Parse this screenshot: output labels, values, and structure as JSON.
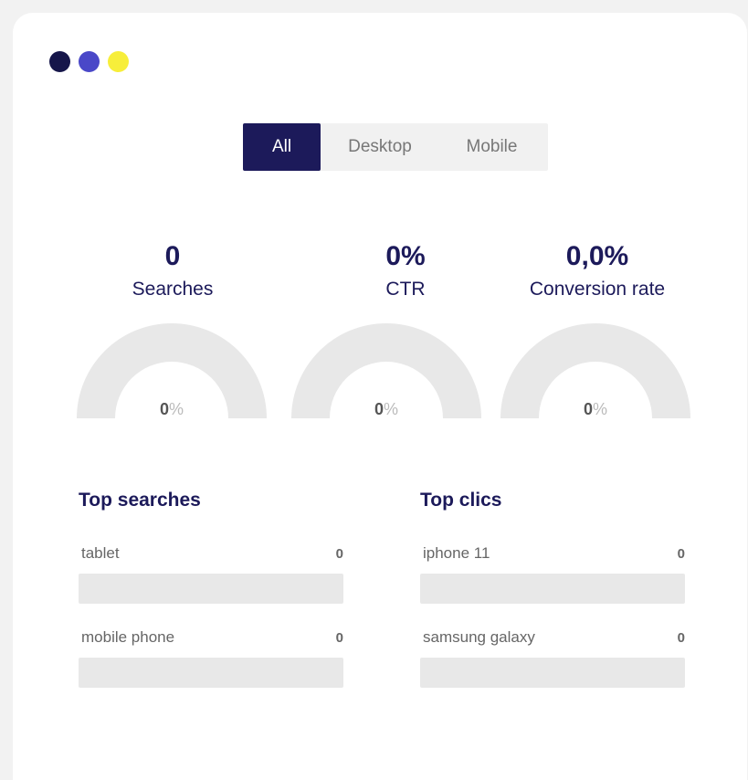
{
  "window_dots": [
    {
      "name": "dot-navy",
      "color": "#16164a"
    },
    {
      "name": "dot-indigo",
      "color": "#4a48c8"
    },
    {
      "name": "dot-yellow",
      "color": "#f7ee3a"
    }
  ],
  "tabs": [
    {
      "label": "All",
      "selected": true
    },
    {
      "label": "Desktop",
      "selected": false
    },
    {
      "label": "Mobile",
      "selected": false
    }
  ],
  "metrics": [
    {
      "value": "0",
      "label": "Searches",
      "gauge_value": "0",
      "gauge_unit": "%",
      "gauge_fraction": 0
    },
    {
      "value": "0%",
      "label": "CTR",
      "gauge_value": "0",
      "gauge_unit": "%",
      "gauge_fraction": 0
    },
    {
      "value": "0,0%",
      "label": "Conversion rate",
      "gauge_value": "0",
      "gauge_unit": "%",
      "gauge_fraction": 0
    }
  ],
  "top_searches": {
    "title": "Top searches",
    "items": [
      {
        "label": "tablet",
        "count": "0",
        "fraction": 0
      },
      {
        "label": "mobile phone",
        "count": "0",
        "fraction": 0
      }
    ]
  },
  "top_clicks": {
    "title": "Top clics",
    "items": [
      {
        "label": "iphone 11",
        "count": "0",
        "fraction": 0
      },
      {
        "label": "samsung galaxy",
        "count": "0",
        "fraction": 0
      }
    ]
  },
  "colors": {
    "accent": "#1c1a5a",
    "track": "#e8e8e8",
    "background": "#f2f2f2"
  }
}
